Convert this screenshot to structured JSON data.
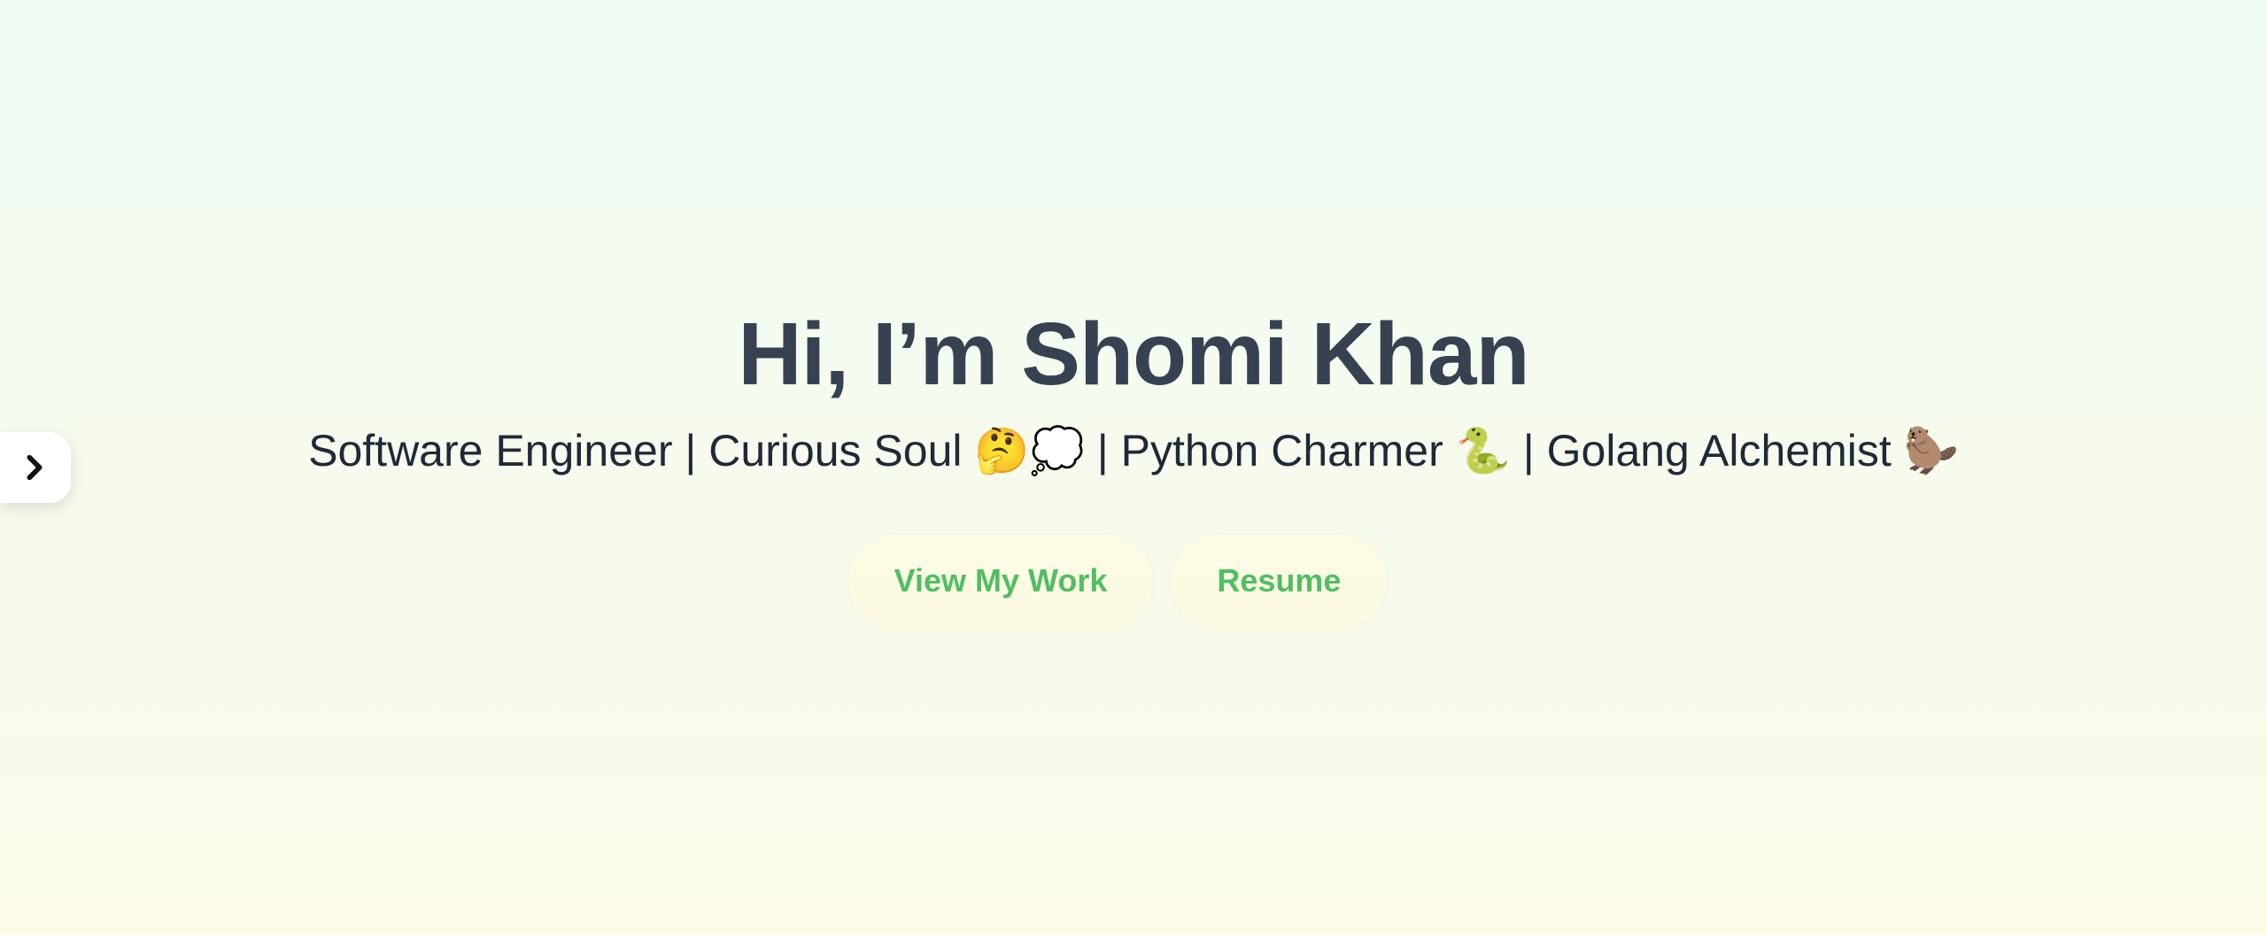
{
  "hero": {
    "title": "Hi, I’m Shomi Khan",
    "subtitle": "Software Engineer | Curious Soul 🤔💭 | Python Charmer 🐍 | Golang Alchemist 🦫"
  },
  "actions": {
    "view_work_label": "View My Work",
    "resume_label": "Resume"
  },
  "sidebar_toggle": {
    "icon": "chevron-right-icon"
  },
  "colors": {
    "title": "#374151",
    "subtitle": "#1f2937",
    "button_text": "#4fbf62",
    "button_bg": "#fffae1",
    "bg_top": "#f0fbf4",
    "bg_bottom": "#fbfbe8"
  }
}
